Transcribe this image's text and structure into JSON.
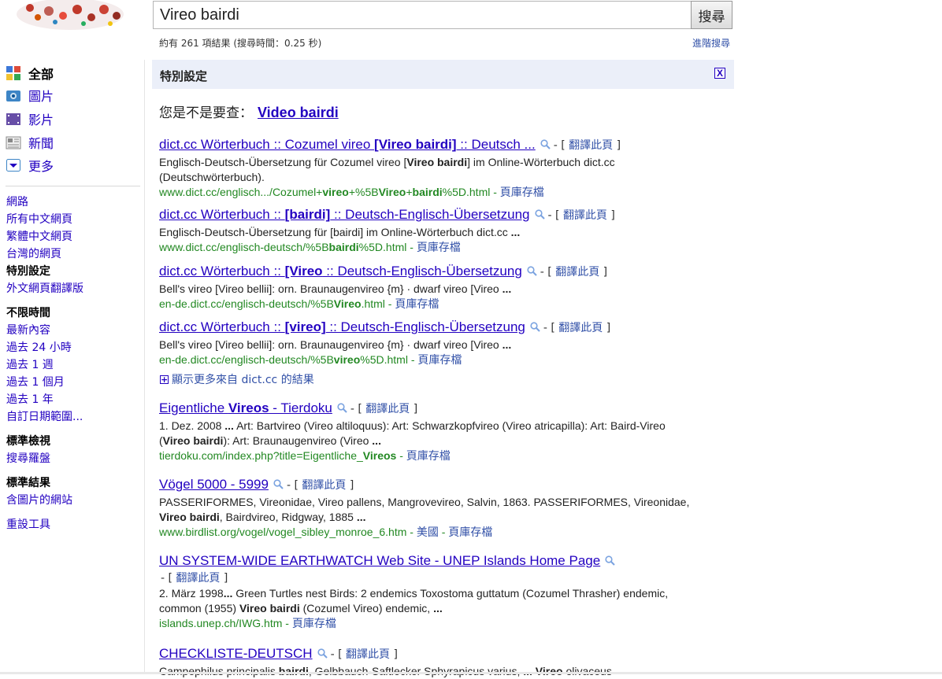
{
  "search": {
    "query": "Vireo bairdi",
    "button_label": "搜尋",
    "result_stats": "約有 261 項結果 (搜尋時間：0.25 秒)",
    "advanced_label": "進階搜尋"
  },
  "sidebar": {
    "types": [
      {
        "label": "全部",
        "icon": "all-results-icon"
      },
      {
        "label": "圖片",
        "icon": "images-icon"
      },
      {
        "label": "影片",
        "icon": "videos-icon"
      },
      {
        "label": "新聞",
        "icon": "news-icon"
      },
      {
        "label": "更多",
        "icon": "more-dropdown-icon"
      }
    ],
    "scope": [
      "網路",
      "所有中文網頁",
      "繁體中文網頁",
      "台灣的網頁"
    ],
    "special_head": "特別設定",
    "special_link": "外文網頁翻譯版",
    "time_head": "不限時間",
    "time": [
      "最新內容",
      "過去 24 小時",
      "過去 1 週",
      "過去 1 個月",
      "過去 1 年",
      "自訂日期範圍..."
    ],
    "view_head": "標準檢視",
    "view_link": "搜尋羅盤",
    "results_head": "標準結果",
    "results_link": "含圖片的網站",
    "reset": "重設工具"
  },
  "main": {
    "special_title": "特別設定",
    "close_label": "X",
    "did_you_mean_label": "您是不是要查：",
    "did_you_mean_query": "Video bairdi",
    "translate_label": "翻譯此頁",
    "cache_label": "頁庫存檔",
    "more_from_label": "顯示更多來自 dict.cc 的結果",
    "results": [
      {
        "title_pre": "dict.cc Wörterbuch :: Cozumel vireo ",
        "title_bold": "[Vireo bairdi]",
        "title_post": " :: Deutsch ...",
        "snippet": "Englisch-Deutsch-Übersetzung für Cozumel vireo [<b>Vireo bairdi</b>] im Online-Wörterbuch dict.cc (Deutschwörterbuch).",
        "url": "www.dict.cc/englisch.../Cozumel+<b>vireo</b>+%5B<b>Vireo</b>+<b>bairdi</b>%5D.html"
      },
      {
        "title_pre": "dict.cc Wörterbuch :: ",
        "title_bold": "[bairdi]",
        "title_post": " :: Deutsch-Englisch-Übersetzung",
        "snippet": "Englisch-Deutsch-Übersetzung für [bairdi] im Online-Wörterbuch dict.cc <b>...</b>",
        "url": "www.dict.cc/englisch-deutsch/%5B<b>bairdi</b>%5D.html"
      },
      {
        "title_pre": "dict.cc Wörterbuch :: ",
        "title_bold": "[Vireo",
        "title_post": " :: Deutsch-Englisch-Übersetzung",
        "snippet": "Bell's vireo [Vireo bellii]: orn. Braunaugenvireo {m} · dwarf vireo [Vireo <b>...</b>",
        "url": "en-de.dict.cc/englisch-deutsch/%5B<b>Vireo</b>.html"
      },
      {
        "title_pre": "dict.cc Wörterbuch :: ",
        "title_bold": "[vireo]",
        "title_post": " :: Deutsch-Englisch-Übersetzung",
        "snippet": "Bell's vireo [Vireo bellii]: orn. Braunaugenvireo {m} · dwarf vireo [Vireo <b>...</b>",
        "url": "en-de.dict.cc/englisch-deutsch/%5B<b>vireo</b>%5D.html"
      },
      {
        "title_pre": "Eigentliche ",
        "title_bold": "Vireos",
        "title_post": " - Tierdoku",
        "snippet": "1. Dez. 2008 <b>...</b> Art: Bartvireo (Vireo altiloquus): Art: Schwarzkopfvireo (Vireo atricapilla): Art: Baird-Vireo (<b>Vireo bairdi</b>): Art: Braunaugenvireo (Vireo <b>...</b>",
        "url": "tierdoku.com/index.php?title=Eigentliche_<b>Vireos</b>"
      },
      {
        "title_pre": "Vögel 5000 - 5999",
        "title_bold": "",
        "title_post": "",
        "snippet": "PASSERIFORMES, Vireonidae, Vireo pallens, Mangrovevireo, Salvin, 1863. PASSERIFORMES, Vireonidae, <b>Vireo bairdi</b>, Bairdvireo, Ridgway, 1885 <b>...</b>",
        "url": "www.birdlist.org/vogel/vogel_sibley_monroe_6.htm",
        "loc": "美國"
      },
      {
        "title_pre": "UN SYSTEM-WIDE EARTHWATCH Web Site - UNEP Islands Home Page",
        "title_bold": "",
        "title_post": "",
        "snippet": "2. März 1998<b>...</b> Green Turtles nest Birds: 2 endemics Toxostoma guttatum (Cozumel Thrasher) endemic, common (1955) <b>Vireo bairdi</b> (Cozumel Vireo) endemic, <b>...</b>",
        "url": "islands.unep.ch/IWG.htm"
      },
      {
        "title_pre": "CHECKLISTE-DEUTSCH",
        "title_bold": "",
        "title_post": "",
        "snippet": "Campephilus principalis <b>bairdi</b>, Gelbbauch-Saftlecker Sphyrapicus varius, <b>...</b> <b>Vireo</b> olivaceus",
        "url": ""
      }
    ]
  }
}
